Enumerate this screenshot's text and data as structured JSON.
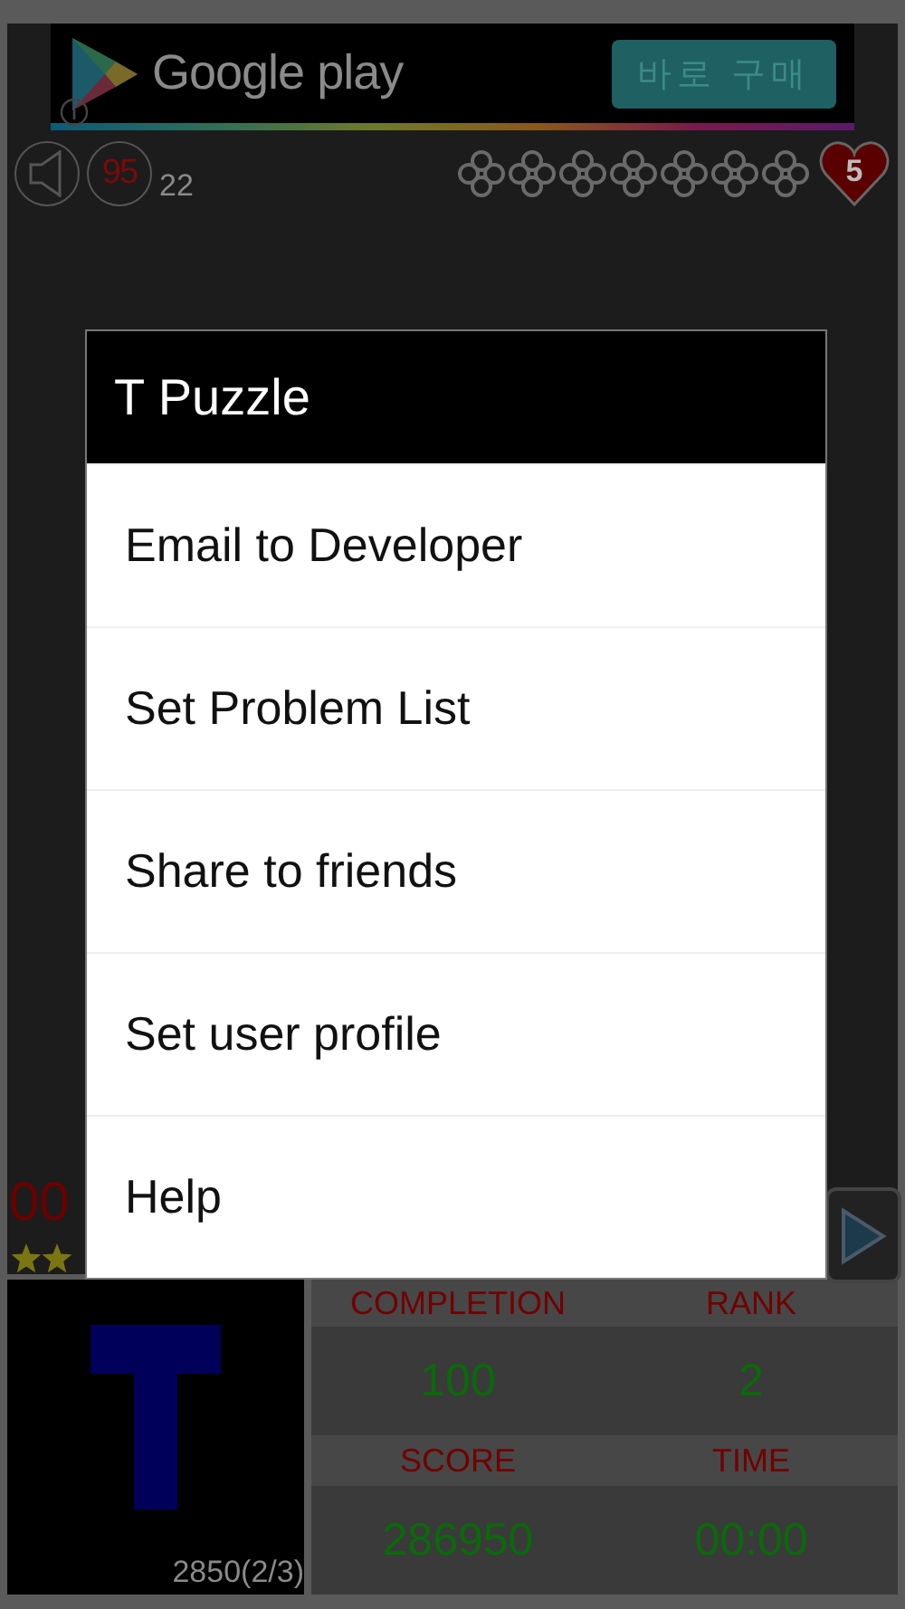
{
  "ad": {
    "brand": "Google play",
    "button": "바로 구매"
  },
  "status": {
    "timer": "95",
    "count": "22",
    "clovers": [
      {
        "filled": false
      },
      {
        "filled": false
      },
      {
        "filled": false
      },
      {
        "filled": false
      },
      {
        "filled": false
      },
      {
        "filled": false
      },
      {
        "filled": false
      }
    ],
    "lives": "5"
  },
  "puzzle": {
    "partial_score": "00",
    "star_icons": [
      {
        "filled": true
      },
      {
        "filled": true
      }
    ]
  },
  "dialog": {
    "title": "T Puzzle",
    "items": [
      "Email to Developer",
      "Set Problem List",
      "Share to friends",
      "Set user profile",
      "Help"
    ]
  },
  "piece": {
    "caption": "2850(2/3)"
  },
  "stats": [
    {
      "label": "COMPLETION",
      "value": "100"
    },
    {
      "label": "RANK",
      "value": "2"
    },
    {
      "label": "SCORE",
      "value": "286950"
    },
    {
      "label": "TIME",
      "value": "00:00"
    }
  ]
}
